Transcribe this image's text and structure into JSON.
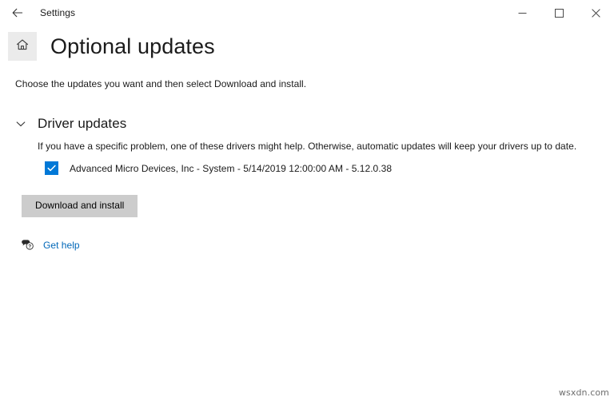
{
  "window": {
    "title": "Settings",
    "back_icon": "back-arrow-icon",
    "controls": {
      "minimize": "minimize-icon",
      "maximize": "maximize-icon",
      "close": "close-icon"
    }
  },
  "header": {
    "home_icon": "home-icon",
    "title": "Optional updates"
  },
  "main": {
    "subtitle": "Choose the updates you want and then select Download and install.",
    "section": {
      "chevron_icon": "chevron-down-icon",
      "title": "Driver updates",
      "description": "If you have a specific problem, one of these drivers might help. Otherwise, automatic updates will keep your drivers up to date.",
      "items": [
        {
          "checked": true,
          "label": "Advanced Micro Devices, Inc - System - 5/14/2019 12:00:00 AM - 5.12.0.38"
        }
      ]
    },
    "download_button": "Download and install",
    "help": {
      "icon": "help-bubble-icon",
      "label": "Get help"
    }
  },
  "watermark": "wsxdn.com",
  "colors": {
    "accent": "#0078d7",
    "link": "#0067b8",
    "button_bg": "#cccccc",
    "home_bg": "#ebebeb"
  }
}
